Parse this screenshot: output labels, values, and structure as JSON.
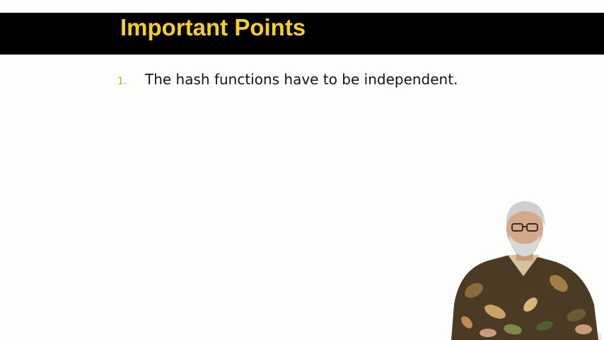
{
  "slide": {
    "title": "Important Points",
    "points": [
      {
        "number": "1.",
        "text": "The hash functions have to be independent."
      }
    ]
  },
  "colors": {
    "title_bar": "#000000",
    "title_text": "#f5cf26",
    "bullet_number": "#c9a21a",
    "body_text": "#141414",
    "background": "#fdfdfb"
  },
  "presenter": {
    "icon": "presenter-video-icon"
  }
}
